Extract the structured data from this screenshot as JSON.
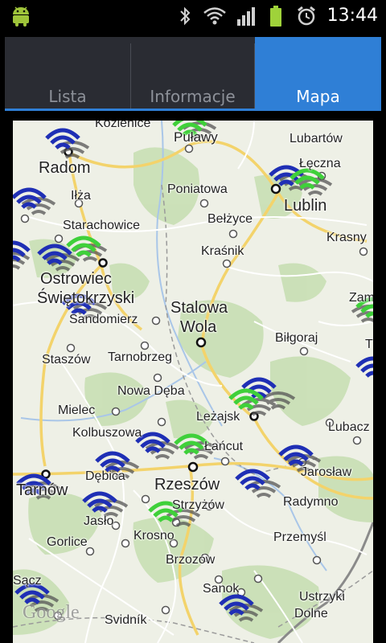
{
  "status_bar": {
    "time": "13:44",
    "icons": [
      "android-icon",
      "bluetooth-icon",
      "wifi-icon",
      "signal-icon",
      "battery-icon",
      "alarm-icon"
    ]
  },
  "tabs": [
    {
      "label": "Lista",
      "selected": false
    },
    {
      "label": "Informacje",
      "selected": false
    },
    {
      "label": "Mapa",
      "selected": true
    }
  ],
  "map": {
    "attribution": "Google",
    "cities": {
      "kozienice": "Kozienice",
      "pulawy": "Puławy",
      "lubartow": "Lubartów",
      "radom": "Radom",
      "leczna": "Łęczna",
      "ilza": "Iłża",
      "poniatowa": "Poniatowa",
      "lublin": "Lublin",
      "belzyce": "Bełżyce",
      "starachowice": "Starachowice",
      "krasnystaw": "Krasny",
      "krasnik": "Kraśnik",
      "ostrowiec": "Ostrowiec",
      "swietokrzyski": "Świętokrzyski",
      "zamosc": "Zam",
      "stalowa": "Stalowa",
      "wola": "Wola",
      "sandomierz": "Sandomierz",
      "bilgoraj": "Biłgoraj",
      "t_edge": "T",
      "staszow": "Staszów",
      "tarnobrzeg": "Tarnobrzeg",
      "nowa_deba": "Nowa Dęba",
      "mielec": "Mielec",
      "lezajsk": "Leżajsk",
      "lubaczow": "Lubacz",
      "kolbuszowa": "Kolbuszowa",
      "lancut": "Łańcut",
      "debica": "Dębica",
      "jaroslaw": "Jarosław",
      "tarnow": "Tarnów",
      "rzeszow": "Rzeszów",
      "radymno": "Radymno",
      "strzyzow": "Strzyżów",
      "jaslo": "Jasło",
      "krosno": "Krosno",
      "gorlice": "Gorlice",
      "przemysl": "Przemyśl",
      "brzozow": "Brzozów",
      "sanok": "Sanok",
      "ustrzyki": "Ustrzyki",
      "dolne": "Dolne",
      "svidnik": "Svidník",
      "s_edge": "Sącz"
    },
    "marker_colors": {
      "blue": "#1f2fb5",
      "green": "#3fd03a",
      "shadow": "#555555"
    },
    "map_colors": {
      "land": "#eef0e6",
      "forest": "#c8dfb4",
      "road_major": "#f3d36b",
      "road_minor": "#ffffff",
      "border": "#9a9a9a"
    }
  }
}
